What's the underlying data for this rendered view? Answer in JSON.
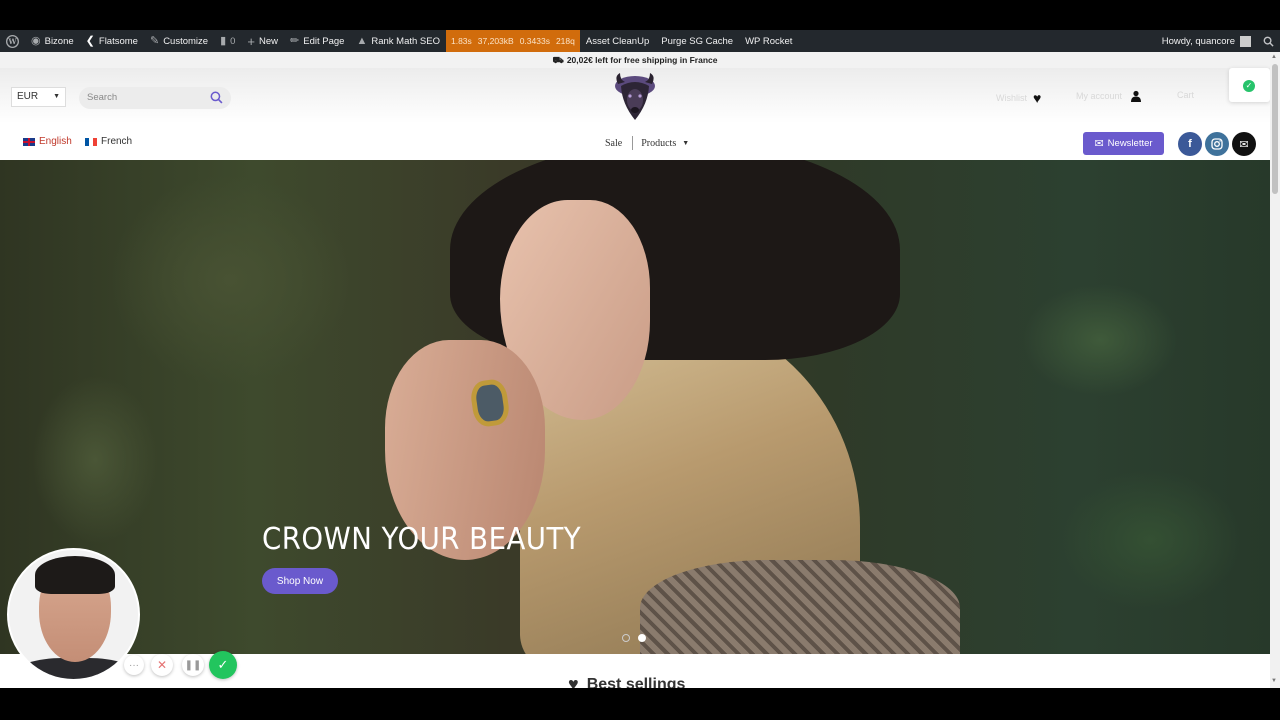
{
  "adminbar": {
    "site": "Bizone",
    "theme": "Flatsome",
    "customize": "Customize",
    "comments": "0",
    "new": "New",
    "edit_page": "Edit Page",
    "rank_math": "Rank Math SEO",
    "perf": [
      "1.83s",
      "37,203kB",
      "0.3433s",
      "218q"
    ],
    "asset_cleanup": "Asset CleanUp",
    "purge": "Purge SG Cache",
    "wp_rocket": "WP Rocket",
    "howdy": "Howdy, quancore"
  },
  "shipping": {
    "text": "20,02€ left for free shipping in France"
  },
  "header": {
    "currency": "EUR",
    "search_placeholder": "Search",
    "wishlist_label": "Wishlist",
    "account_label": "My account",
    "cart_label": "Cart"
  },
  "languages": [
    {
      "label": "English"
    },
    {
      "label": "French"
    }
  ],
  "nav": {
    "sale": "Sale",
    "products": "Products"
  },
  "newsletter": "Newsletter",
  "hero": {
    "title": "CROWN YOUR BEAUTY",
    "button": "Shop Now",
    "slides": 2,
    "active_slide": 2
  },
  "section": {
    "title": "Best sellings"
  },
  "colors": {
    "accent": "#6a5acd",
    "adminbar": "#23282d",
    "perf": "#d16c0c",
    "facebook": "#3b5998",
    "instagram": "#3f729b",
    "email": "#111111"
  },
  "icons": [
    "wordpress-icon",
    "home-icon",
    "flatsome-icon",
    "brush-icon",
    "comment-icon",
    "plus-icon",
    "pencil-icon",
    "rankmath-icon",
    "search-icon",
    "heart-icon",
    "user-icon",
    "mail-icon",
    "facebook-icon",
    "instagram-icon"
  ]
}
